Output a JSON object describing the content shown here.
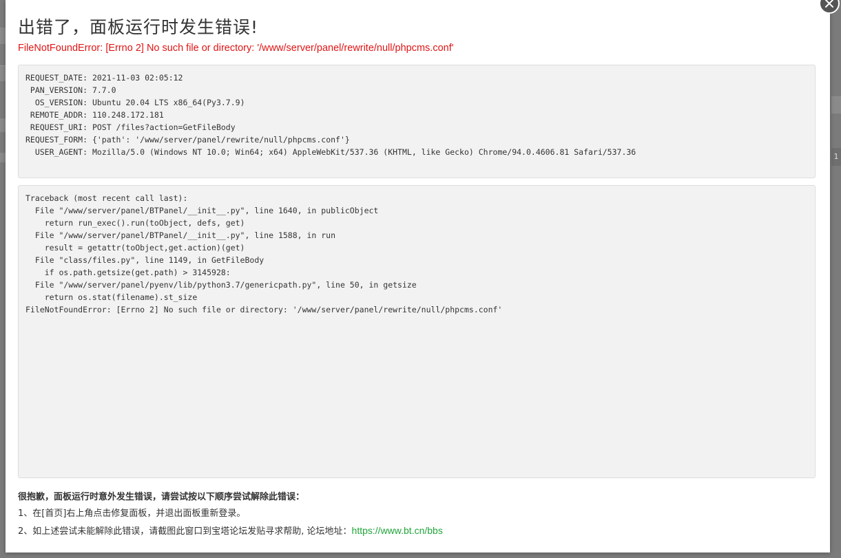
{
  "dialog": {
    "title": "出错了，面板运行时发生错误!",
    "error": "FileNotFoundError: [Errno 2] No such file or directory: '/www/server/panel/rewrite/null/phpcms.conf'"
  },
  "request_info": [
    {
      "key": "REQUEST_DATE",
      "value": "2021-11-03 02:05:12"
    },
    {
      "key": "PAN_VERSION",
      "value": "7.7.0"
    },
    {
      "key": "OS_VERSION",
      "value": "Ubuntu 20.04 LTS x86_64(Py3.7.9)"
    },
    {
      "key": "REMOTE_ADDR",
      "value": "110.248.172.181"
    },
    {
      "key": "REQUEST_URI",
      "value": "POST /files?action=GetFileBody"
    },
    {
      "key": "REQUEST_FORM",
      "value": "{'path': '/www/server/panel/rewrite/null/phpcms.conf'}"
    },
    {
      "key": "USER_AGENT",
      "value": "Mozilla/5.0 (Windows NT 10.0; Win64; x64) AppleWebKit/537.36 (KHTML, like Gecko) Chrome/94.0.4606.81 Safari/537.36"
    }
  ],
  "traceback": [
    "Traceback (most recent call last):",
    "  File \"/www/server/panel/BTPanel/__init__.py\", line 1640, in publicObject",
    "    return run_exec().run(toObject, defs, get)",
    "  File \"/www/server/panel/BTPanel/__init__.py\", line 1588, in run",
    "    result = getattr(toObject,get.action)(get)",
    "  File \"class/files.py\", line 1149, in GetFileBody",
    "    if os.path.getsize(get.path) > 3145928:",
    "  File \"/www/server/panel/pyenv/lib/python3.7/genericpath.py\", line 50, in getsize",
    "    return os.stat(filename).st_size",
    "FileNotFoundError: [Errno 2] No such file or directory: '/www/server/panel/rewrite/null/phpcms.conf'"
  ],
  "help": {
    "heading": "很抱歉，面板运行时意外发生错误，请尝试按以下顺序尝试解除此错误：",
    "step1": "1、在[首页]右上角点击修复面板，并退出面板重新登录。",
    "step2_prefix": "2、如上述尝试未能解除此错误，请截图此窗口到宝塔论坛发贴寻求帮助, 论坛地址：",
    "forum_link": "https://www.bt.cn/bbs"
  },
  "background": {
    "page_number": "1"
  },
  "colors": {
    "error_red": "#e01414",
    "link_green": "#20a53a",
    "overlay": "#7b7b7b"
  },
  "icons": {
    "close": "close-icon"
  }
}
